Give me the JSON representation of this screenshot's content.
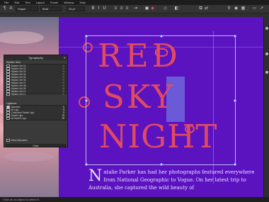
{
  "menubar": {
    "items": [
      "File",
      "Edit",
      "Text",
      "Layout",
      "Frame",
      "Window",
      "Help"
    ]
  },
  "toolbar": {
    "font_name": "Vogue",
    "font_style": "Bold",
    "font_size": "24 pt"
  },
  "document": {
    "headline": [
      "RED",
      "SKY",
      "NIGHT"
    ],
    "dropcap": "N",
    "body": "atalie Parker has had her photographs featured everywhere from National Geographic to Vogue. On her latest trip to Australia, she captured the wild beauty of"
  },
  "typography_panel": {
    "title": "Typography",
    "section1": "Stylistic Sets",
    "stylistic_sets": [
      "Stylistic Set 01",
      "Stylistic Set 02",
      "Stylistic Set 03",
      "Stylistic Set 04",
      "Stylistic Set 05",
      "Stylistic Set 06",
      "Stylistic Set 07",
      "Stylistic Set 08",
      "Stylistic Set 09",
      "Stylistic Set 10",
      "Stylistic Set 11"
    ],
    "section2": "Ligatures",
    "ligatures": [
      "Standard",
      "Alt Liga",
      "Contextual Swash Liga",
      "Swash Liga",
      "Alt Swash Liga"
    ],
    "option_last": "Show Alternates",
    "button": "Close"
  },
  "status": {
    "text": "Click on an object to select it."
  },
  "colors": {
    "canvas_bg": "#5b12bf",
    "headline": "#e14b62",
    "selection": "#7896eb"
  }
}
